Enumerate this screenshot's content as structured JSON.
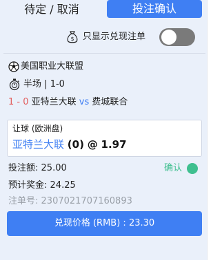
{
  "tabs": {
    "pending_label": "待定 / 取消",
    "confirmed_label": "投注确认"
  },
  "filter": {
    "label": "只显示兑现注单",
    "toggle_on": false
  },
  "bet": {
    "league": "美国职业大联盟",
    "period": "半场",
    "separator": "|",
    "period_score": "1-0",
    "match": {
      "score": "1 - 0",
      "home": "亚特兰大联",
      "vs": "vs",
      "away": "费城联合"
    },
    "market": "让球 (欧洲盘)",
    "selection": {
      "team": "亚特兰大联",
      "handicap": "(0)",
      "at": "@",
      "odds": "1.97"
    },
    "stake_label": "投注额:",
    "stake": "25.00",
    "payout_label": "预计奖金:",
    "payout": "24.25",
    "ticket_label": "注单号:",
    "ticket_no": "2307021707160893",
    "status": "确认",
    "cashout_label": "兑现价格 (RMB) :",
    "cashout_value": "23.30"
  },
  "colors": {
    "primary": "#3f7ff3",
    "score_red": "#e25c5c",
    "confirm_green": "#3fbf8f",
    "panel_bg": "#eaf0fa"
  },
  "icons": {
    "filter": "money-bag-icon",
    "league": "soccer-ball-icon",
    "time": "stopwatch-icon",
    "status": "status-dot-icon"
  }
}
